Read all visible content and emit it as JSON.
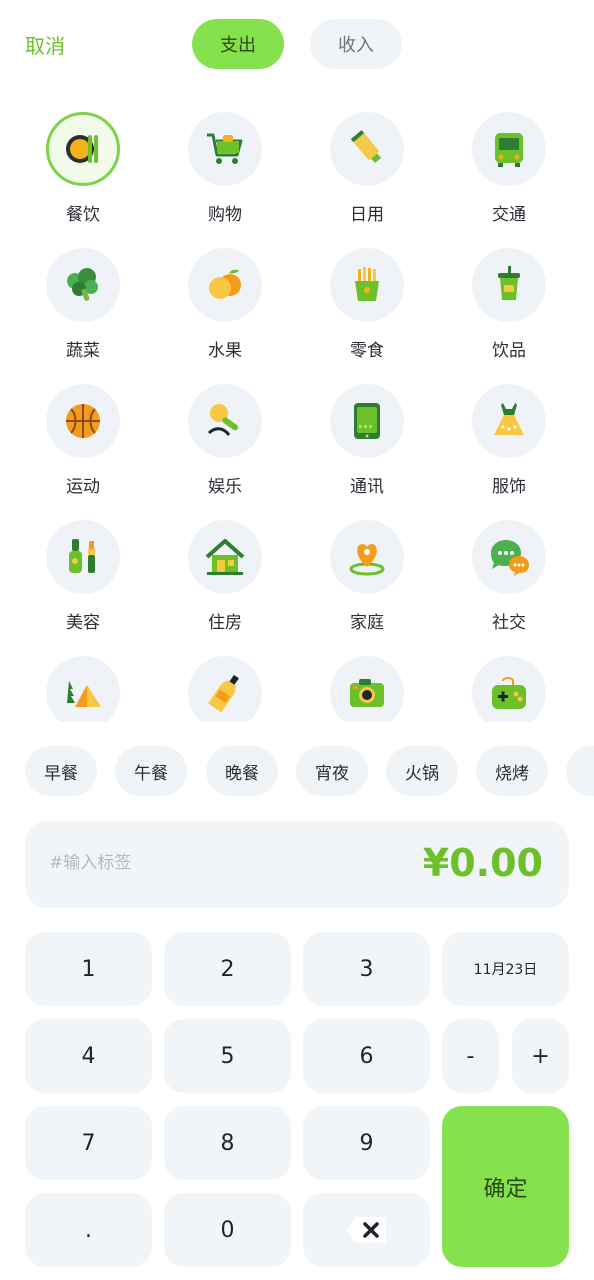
{
  "header": {
    "cancel_label": "取消",
    "tab_expense": "支出",
    "tab_income": "收入"
  },
  "categories": [
    {
      "label": "餐饮",
      "icon": "dining-icon",
      "selected": true
    },
    {
      "label": "购物",
      "icon": "shopping-cart-icon"
    },
    {
      "label": "日用",
      "icon": "daily-tube-icon"
    },
    {
      "label": "交通",
      "icon": "bus-icon"
    },
    {
      "label": "蔬菜",
      "icon": "broccoli-icon"
    },
    {
      "label": "水果",
      "icon": "orange-icon"
    },
    {
      "label": "零食",
      "icon": "fries-icon"
    },
    {
      "label": "饮品",
      "icon": "drink-cup-icon"
    },
    {
      "label": "运动",
      "icon": "basketball-icon"
    },
    {
      "label": "娱乐",
      "icon": "microphone-icon"
    },
    {
      "label": "通讯",
      "icon": "phone-icon"
    },
    {
      "label": "服饰",
      "icon": "dress-icon"
    },
    {
      "label": "美容",
      "icon": "nail-polish-icon"
    },
    {
      "label": "住房",
      "icon": "house-icon"
    },
    {
      "label": "家庭",
      "icon": "family-heart-icon"
    },
    {
      "label": "社交",
      "icon": "chat-bubbles-icon"
    },
    {
      "label": "",
      "icon": "tent-icon"
    },
    {
      "label": "",
      "icon": "bottle-icon"
    },
    {
      "label": "",
      "icon": "camera-icon"
    },
    {
      "label": "",
      "icon": "game-console-icon"
    }
  ],
  "subcategories": [
    "早餐",
    "午餐",
    "晚餐",
    "宵夜",
    "火锅",
    "烧烤"
  ],
  "amount_box": {
    "tag_placeholder": "#输入标签",
    "amount": "¥0.00"
  },
  "keypad": {
    "k1": "1",
    "k2": "2",
    "k3": "3",
    "k4": "4",
    "k5": "5",
    "k6": "6",
    "k7": "7",
    "k8": "8",
    "k9": "9",
    "dot": ".",
    "k0": "0",
    "date": "11月23日",
    "minus": "-",
    "plus": "+",
    "confirm": "确定"
  },
  "colors": {
    "accent": "#86e14e",
    "accent_text": "#6cc12b",
    "key_bg": "#f1f5f8"
  }
}
